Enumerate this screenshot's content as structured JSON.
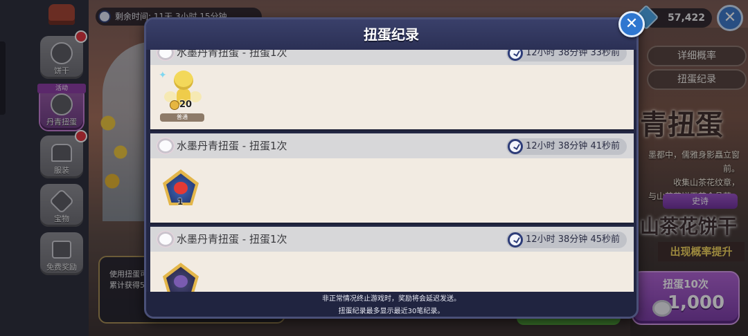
{
  "background": {
    "timer_text": "剩余时间: 11天 3小时 15分钟",
    "gem_count": "57,422",
    "right_buttons": [
      "详细概率",
      "扭蛋纪录"
    ],
    "banner_title": "青扭蛋",
    "banner_desc": [
      "墨都中，儒雅身影矗立窗前。",
      "收集山茶花纹章，",
      "与山茶花饼干茶会品茗。"
    ],
    "rarity_label": "史诗",
    "cookie_name": "山茶花饼干",
    "rate_up": "出现概率提升",
    "pull10_label": "扭蛋10次",
    "pull10_cost": "1,000",
    "promo_lines": [
      "使用扭蛋可",
      "累计获得5"
    ],
    "close_glyph": "✕"
  },
  "sidebar": {
    "event_ribbon": "活动",
    "items": [
      {
        "label": "饼干",
        "badge": true
      },
      {
        "label": "丹青扭蛋",
        "badge": false,
        "active": true
      },
      {
        "label": "服装",
        "badge": true
      },
      {
        "label": "宝物",
        "badge": false
      },
      {
        "label": "免费奖励",
        "badge": false
      }
    ]
  },
  "modal": {
    "title": "扭蛋纪录",
    "close_glyph": "✕",
    "records": [
      {
        "title": "水墨丹青扭蛋 - 扭蛋1次",
        "time": "12小时 38分钟 33秒前",
        "reward": {
          "kind": "cookie",
          "count": "20",
          "tag": "普通"
        }
      },
      {
        "title": "水墨丹青扭蛋 - 扭蛋1次",
        "time": "12小时 38分钟 41秒前",
        "reward": {
          "kind": "gem",
          "count": "1"
        }
      },
      {
        "title": "水墨丹青扭蛋 - 扭蛋1次",
        "time": "12小时 38分钟 45秒前",
        "reward": {
          "kind": "gem-dark",
          "count": ""
        }
      }
    ],
    "footer_lines": [
      "非正常情况终止游戏时，奖励将会延迟发送。",
      "扭蛋纪录最多显示最近30笔纪录。"
    ]
  }
}
